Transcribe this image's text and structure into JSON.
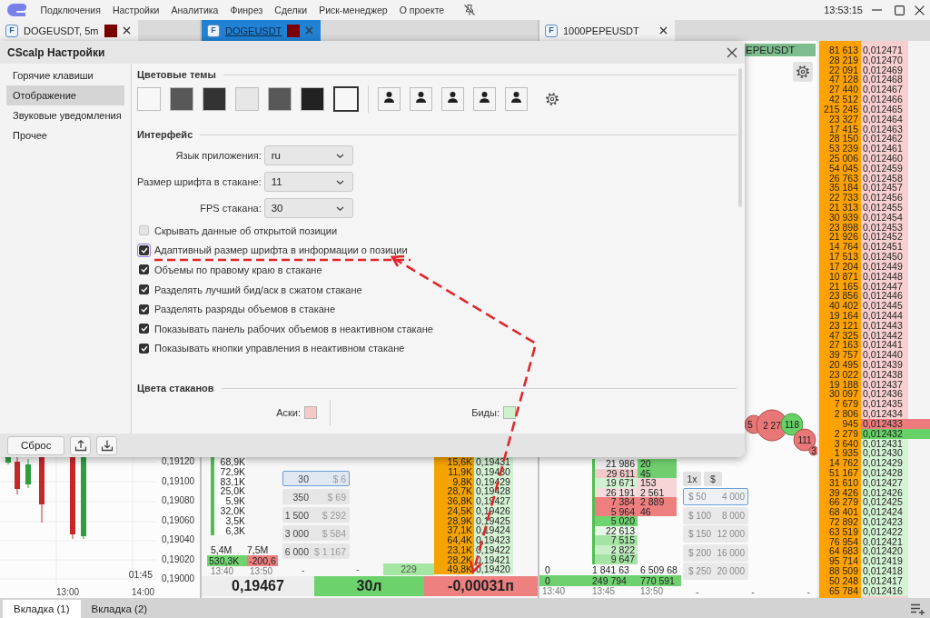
{
  "menu_bar": {
    "items": [
      "Подключения",
      "Настройки",
      "Аналитика",
      "Финрез",
      "Сделки",
      "Риск-менеджер",
      "О проекте"
    ],
    "clock": "13:53:15"
  },
  "tabs": [
    {
      "badge": "F",
      "label": "DOGEUSDT, 5m",
      "color": "#7a0000",
      "selected": false
    },
    {
      "badge": "F",
      "label": "DOGEUSDT",
      "color": "#7a0000",
      "selected": true
    },
    {
      "badge": "F",
      "label": "1000PEPEUSDT",
      "selected": false
    }
  ],
  "chart": {
    "price_labels": [
      "0,19120",
      "0,19100",
      "0,19080",
      "0,19060",
      "0,19040",
      "0,19020",
      "0,19000"
    ],
    "countdown": "01:45",
    "time_labels": [
      "13:00",
      "14:00"
    ]
  },
  "doge_book": {
    "cluster_volumes": [
      "68,9K",
      "72,9K",
      "83,1K",
      "25,0K",
      "5,9K",
      "32,0K",
      "3,5K",
      "6,3K"
    ],
    "totals": [
      "5,4M",
      "7,5M"
    ],
    "deltas": [
      {
        "value": "530,3K",
        "kind": "buy"
      },
      {
        "value": "-200,6",
        "kind": "sell"
      }
    ],
    "times": [
      "13:40",
      "13:50"
    ],
    "presets": [
      {
        "amount": "30",
        "usd": "$ 6",
        "selected": true
      },
      {
        "amount": "350",
        "usd": "$ 69",
        "selected": false
      },
      {
        "amount": "1 500",
        "usd": "$ 292",
        "selected": false
      },
      {
        "amount": "3 000",
        "usd": "$ 584",
        "selected": false
      },
      {
        "amount": "6 000",
        "usd": "$ 1 167",
        "selected": false
      }
    ],
    "dashes": [
      "-",
      "-"
    ],
    "trades_count": "229",
    "ladder": [
      {
        "volume": "15,6K",
        "price": "0,19431"
      },
      {
        "volume": "11,9K",
        "price": "0,19430"
      },
      {
        "volume": "9,8K",
        "price": "0,19429"
      },
      {
        "volume": "28,7K",
        "price": "0,19428"
      },
      {
        "volume": "36,8K",
        "price": "0,19427"
      },
      {
        "volume": "24,5K",
        "price": "0,19426"
      },
      {
        "volume": "28,9K",
        "price": "0,19425"
      },
      {
        "volume": "37,1K",
        "price": "0,19424"
      },
      {
        "volume": "64,4K",
        "price": "0,19423"
      },
      {
        "volume": "23,1K",
        "price": "0,19422"
      },
      {
        "volume": "28,2K",
        "price": "0,19421"
      },
      {
        "volume": "49,8K",
        "price": "0,19420"
      }
    ],
    "last_price": "0,19467",
    "position": "30л",
    "pnl": "-0,00031п"
  },
  "pepe_book": {
    "header": "EPEUSDT",
    "bubbles": [
      {
        "label": "5",
        "kind": "sell"
      },
      {
        "label": "2 27",
        "kind": "sell"
      },
      {
        "label": "118",
        "kind": "buy"
      },
      {
        "label": "111",
        "kind": "sell"
      },
      {
        "label": "3",
        "kind": "sell"
      }
    ],
    "cluster_volumes": [
      {
        "value": "21 986",
        "color": "#ececec"
      },
      {
        "value": "29 611",
        "color": "#f2caca"
      },
      {
        "value": "19 671",
        "color": "#d2f0d2"
      },
      {
        "value": "26 191",
        "color": "#f4dcdc"
      },
      {
        "value": "7 384",
        "color": "#ee7f7f"
      },
      {
        "value": "5 964",
        "color": "#ee7f7f"
      },
      {
        "value": "5 020",
        "color": "#6fd46f"
      },
      {
        "value": "22 613",
        "color": "#e8f6e8"
      },
      {
        "value": "7 515",
        "color": "#a5e3a5"
      },
      {
        "value": "2 822",
        "color": "#c8eec8"
      },
      {
        "value": "9 647",
        "color": "#a5e3a5"
      }
    ],
    "order_sizes": [
      {
        "value": "20",
        "color": "#6fcf6f"
      },
      {
        "value": "45",
        "color": "#6fcf6f"
      },
      {
        "value": "153",
        "color": "#f5d5d5"
      },
      {
        "value": "2 561",
        "color": "#f5d5d5"
      },
      {
        "value": "2 889",
        "color": "#ee7f7f"
      },
      {
        "value": "46",
        "color": "#ee7f7f"
      }
    ],
    "mode_buttons": [
      "1x",
      "$"
    ],
    "presets": [
      {
        "usd": "$ 50",
        "amount": "4 000",
        "selected": true
      },
      {
        "usd": "$ 100",
        "amount": "8 000",
        "selected": false
      },
      {
        "usd": "$ 150",
        "amount": "12 000",
        "selected": false
      },
      {
        "usd": "$ 200",
        "amount": "16 000",
        "selected": false
      },
      {
        "usd": "$ 250",
        "amount": "20 000",
        "selected": false
      }
    ],
    "stats_row": [
      "0",
      "1 841 63",
      "6 509 68"
    ],
    "position_row": [
      "0",
      "249 794",
      "770 591"
    ],
    "times": [
      "13:40",
      "13:45",
      "13:50"
    ],
    "dashes": [
      "-",
      "-",
      "-"
    ]
  },
  "ladder": [
    {
      "volume": "81 613",
      "price": "0,012471",
      "kind": "ask",
      "best": false
    },
    {
      "volume": "28 219",
      "price": "0,012470",
      "kind": "ask",
      "best": false
    },
    {
      "volume": "22 091",
      "price": "0,012469",
      "kind": "ask",
      "best": false
    },
    {
      "volume": "47 128",
      "price": "0,012468",
      "kind": "ask",
      "best": false
    },
    {
      "volume": "27 440",
      "price": "0,012467",
      "kind": "ask",
      "best": false
    },
    {
      "volume": "42 512",
      "price": "0,012466",
      "kind": "ask",
      "best": false
    },
    {
      "volume": "215 245",
      "price": "0,012465",
      "kind": "ask",
      "best": false
    },
    {
      "volume": "23 327",
      "price": "0,012464",
      "kind": "ask",
      "best": false
    },
    {
      "volume": "17 415",
      "price": "0,012463",
      "kind": "ask",
      "best": false
    },
    {
      "volume": "28 150",
      "price": "0,012462",
      "kind": "ask",
      "best": false
    },
    {
      "volume": "53 239",
      "price": "0,012461",
      "kind": "ask",
      "best": false
    },
    {
      "volume": "25 006",
      "price": "0,012460",
      "kind": "ask",
      "best": false
    },
    {
      "volume": "54 045",
      "price": "0,012459",
      "kind": "ask",
      "best": false
    },
    {
      "volume": "26 763",
      "price": "0,012458",
      "kind": "ask",
      "best": false
    },
    {
      "volume": "35 184",
      "price": "0,012457",
      "kind": "ask",
      "best": false
    },
    {
      "volume": "22 733",
      "price": "0,012456",
      "kind": "ask",
      "best": false
    },
    {
      "volume": "21 313",
      "price": "0,012455",
      "kind": "ask",
      "best": false
    },
    {
      "volume": "30 939",
      "price": "0,012454",
      "kind": "ask",
      "best": false
    },
    {
      "volume": "23 898",
      "price": "0,012453",
      "kind": "ask",
      "best": false
    },
    {
      "volume": "21 926",
      "price": "0,012452",
      "kind": "ask",
      "best": false
    },
    {
      "volume": "14 764",
      "price": "0,012451",
      "kind": "ask",
      "best": false
    },
    {
      "volume": "17 513",
      "price": "0,012450",
      "kind": "ask",
      "best": false
    },
    {
      "volume": "17 204",
      "price": "0,012449",
      "kind": "ask",
      "best": false
    },
    {
      "volume": "10 871",
      "price": "0,012448",
      "kind": "ask",
      "best": false
    },
    {
      "volume": "21 165",
      "price": "0,012447",
      "kind": "ask",
      "best": false
    },
    {
      "volume": "23 856",
      "price": "0,012446",
      "kind": "ask",
      "best": false
    },
    {
      "volume": "40 402",
      "price": "0,012445",
      "kind": "ask",
      "best": false
    },
    {
      "volume": "19 164",
      "price": "0,012444",
      "kind": "ask",
      "best": false
    },
    {
      "volume": "23 121",
      "price": "0,012443",
      "kind": "ask",
      "best": false
    },
    {
      "volume": "47 325",
      "price": "0,012442",
      "kind": "ask",
      "best": false
    },
    {
      "volume": "27 163",
      "price": "0,012441",
      "kind": "ask",
      "best": false
    },
    {
      "volume": "39 757",
      "price": "0,012440",
      "kind": "ask",
      "best": false
    },
    {
      "volume": "20 495",
      "price": "0,012439",
      "kind": "ask",
      "best": false
    },
    {
      "volume": "23 022",
      "price": "0,012438",
      "kind": "ask",
      "best": false
    },
    {
      "volume": "19 188",
      "price": "0,012437",
      "kind": "ask",
      "best": false
    },
    {
      "volume": "30 097",
      "price": "0,012436",
      "kind": "ask",
      "best": false
    },
    {
      "volume": "7 679",
      "price": "0,012435",
      "kind": "ask",
      "best": false
    },
    {
      "volume": "2 806",
      "price": "0,012434",
      "kind": "ask",
      "best": false
    },
    {
      "volume": "945",
      "price": "0,012433",
      "kind": "ask",
      "best": true
    },
    {
      "volume": "2 279",
      "price": "0,012432",
      "kind": "bid",
      "best": true
    },
    {
      "volume": "3 640",
      "price": "0,012431",
      "kind": "bid",
      "best": false
    },
    {
      "volume": "1 935",
      "price": "0,012430",
      "kind": "bid",
      "best": false
    },
    {
      "volume": "14 762",
      "price": "0,012429",
      "kind": "bid",
      "best": false
    },
    {
      "volume": "51 167",
      "price": "0,012428",
      "kind": "bid",
      "best": false
    },
    {
      "volume": "31 610",
      "price": "0,012427",
      "kind": "bid",
      "best": false
    },
    {
      "volume": "39 426",
      "price": "0,012426",
      "kind": "bid",
      "best": false
    },
    {
      "volume": "66 279",
      "price": "0,012425",
      "kind": "bid",
      "best": false
    },
    {
      "volume": "68 401",
      "price": "0,012424",
      "kind": "bid",
      "best": false
    },
    {
      "volume": "72 892",
      "price": "0,012423",
      "kind": "bid",
      "best": false
    },
    {
      "volume": "63 519",
      "price": "0,012422",
      "kind": "bid",
      "best": false
    },
    {
      "volume": "76 954",
      "price": "0,012421",
      "kind": "bid",
      "best": false
    },
    {
      "volume": "64 683",
      "price": "0,012420",
      "kind": "bid",
      "best": false
    },
    {
      "volume": "95 714",
      "price": "0,012419",
      "kind": "bid",
      "best": false
    },
    {
      "volume": "88 509",
      "price": "0,012418",
      "kind": "bid",
      "best": false
    },
    {
      "volume": "50 248",
      "price": "0,012417",
      "kind": "bid",
      "best": false
    },
    {
      "volume": "65 784",
      "price": "0,012416",
      "kind": "bid",
      "best": false
    }
  ],
  "dialog": {
    "title": "CScalp Настройки",
    "nav": [
      {
        "label": "Горячие клавиши",
        "selected": false
      },
      {
        "label": "Отображение",
        "selected": true
      },
      {
        "label": "Звуковые уведомления",
        "selected": false
      },
      {
        "label": "Прочее",
        "selected": false
      }
    ],
    "themes_title": "Цветовые темы",
    "themes": [
      {
        "color": "#f7f7f7",
        "selected": false
      },
      {
        "color": "#585858",
        "selected": false
      },
      {
        "color": "#333333",
        "selected": false
      },
      {
        "color": "#e6e6e6",
        "selected": false
      },
      {
        "color": "#585858",
        "selected": false
      },
      {
        "color": "#222222",
        "selected": false
      },
      {
        "color": "#f7f7f7",
        "selected": true
      }
    ],
    "custom_themes": [
      {
        "selected": false
      },
      {
        "selected": false
      },
      {
        "selected": false
      },
      {
        "selected": false
      },
      {
        "selected": false
      }
    ],
    "interface_title": "Интерфейс",
    "fields": [
      {
        "label": "Язык приложения:",
        "value": "ru"
      },
      {
        "label": "Размер шрифта в стакане:",
        "value": "11"
      },
      {
        "label": "FPS стакана:",
        "value": "30"
      }
    ],
    "options": [
      {
        "label": "Скрывать данные об открытой позиции",
        "checked": false,
        "focused": false
      },
      {
        "label": "Адаптивный размер шрифта в информации о позиции",
        "checked": true,
        "focused": true
      },
      {
        "label": "Объемы по правому краю в стакане",
        "checked": true,
        "focused": false
      },
      {
        "label": "Разделять лучший бид/аск в сжатом стакане",
        "checked": true,
        "focused": false
      },
      {
        "label": "Разделять разряды объемов в стакане",
        "checked": true,
        "focused": false
      },
      {
        "label": "Показывать панель рабочих объемов в неактивном стакане",
        "checked": true,
        "focused": false
      },
      {
        "label": "Показывать кнопки управления в неактивном стакане",
        "checked": true,
        "focused": false
      }
    ],
    "book_colors_title": "Цвета стаканов",
    "book_colors": [
      {
        "label": "Аски:",
        "color": "#f7c8c8"
      },
      {
        "label": "Биды:",
        "color": "#cdf3cd"
      }
    ],
    "reset_button": "Сброс"
  },
  "bottom_tabs": [
    {
      "label": "Вкладка (1)",
      "selected": true
    },
    {
      "label": "Вкладка (2)",
      "selected": false
    }
  ]
}
